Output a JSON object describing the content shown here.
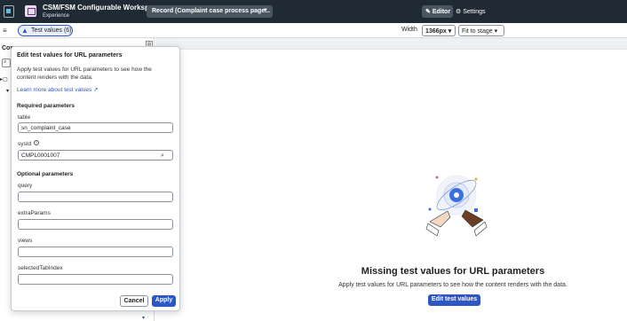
{
  "header": {
    "app_title": "CSM/FSM Configurable Workspace",
    "app_subtitle": "Experience",
    "page_select": "Record (Complaint case process page...",
    "editor_label": "Editor",
    "settings_label": "Settings"
  },
  "toolbar": {
    "test_values_label": "Test values (6)",
    "width_label": "Width",
    "width_value": "1366px",
    "fit_value": "Fit to stage"
  },
  "left_panel": {
    "heading": "Con"
  },
  "popover": {
    "title": "Edit test values for URL parameters",
    "description": "Apply test values for URL parameters to see how the content renders with the data.",
    "learn_more": "Learn more about test values",
    "required_title": "Required parameters",
    "optional_title": "Optional parameters",
    "fields": {
      "table": {
        "label": "table",
        "value": "sn_complaint_case"
      },
      "sysid": {
        "label": "sysId",
        "value": "CMPL0001007"
      },
      "query": {
        "label": "query",
        "value": ""
      },
      "extraParams": {
        "label": "extraParams",
        "value": ""
      },
      "views": {
        "label": "views",
        "value": ""
      },
      "selectedTabIndex": {
        "label": "selectedTabIndex",
        "value": ""
      }
    },
    "cancel_label": "Cancel",
    "apply_label": "Apply"
  },
  "empty_state": {
    "title": "Missing test values for URL parameters",
    "description": "Apply test values for URL parameters to see how the content renders with the data.",
    "button_label": "Edit test values"
  },
  "colors": {
    "header_bg": "#1f2a34",
    "primary": "#2d57c4"
  }
}
